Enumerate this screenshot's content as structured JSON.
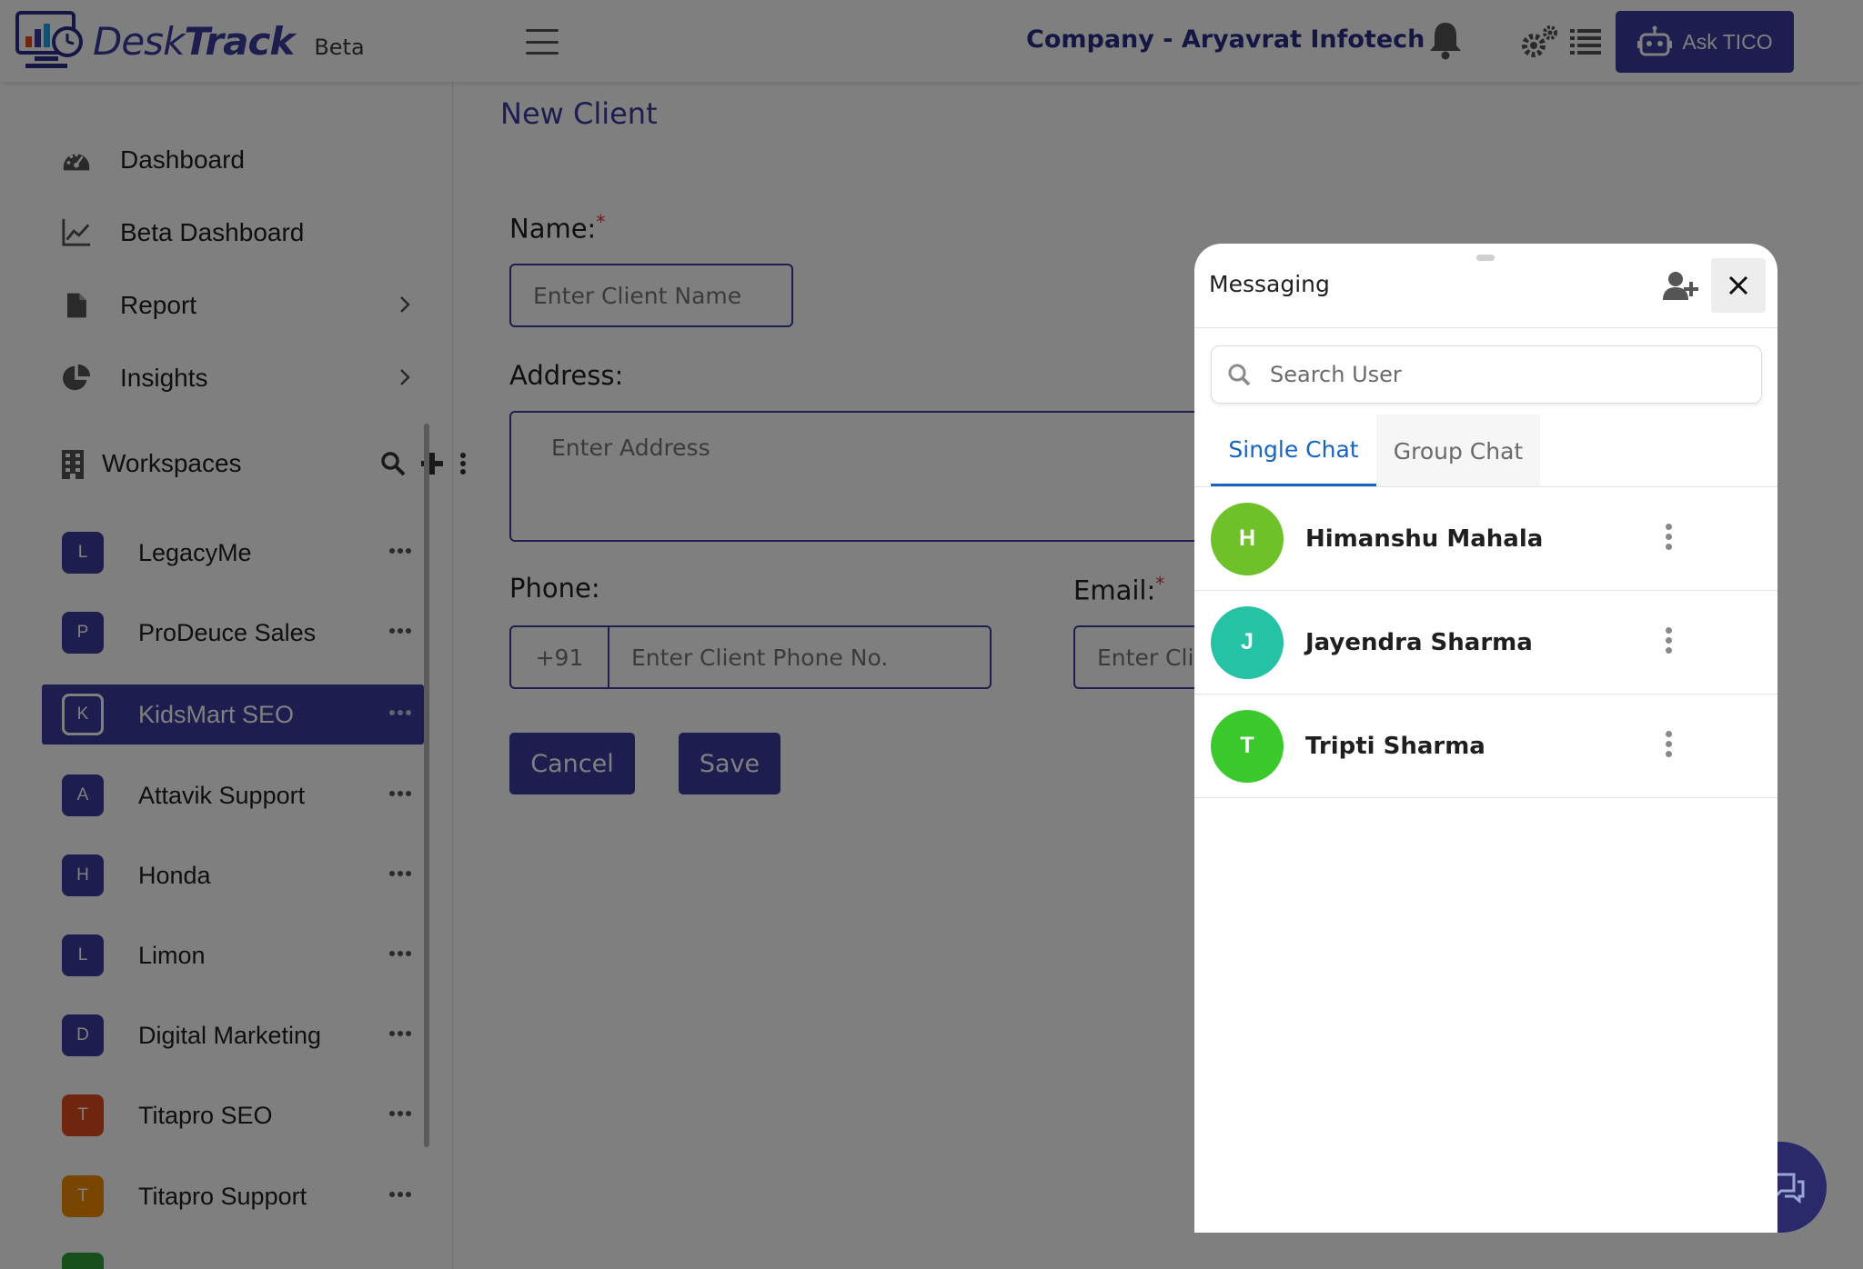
{
  "header": {
    "logo_main": "Desk",
    "logo_bold": "Track",
    "beta": "Beta",
    "company": "Company - Aryavrat Infotech",
    "ask_button": "Ask TICO"
  },
  "sidebar": {
    "nav": [
      {
        "label": "Dashboard",
        "icon": "dashboard-icon"
      },
      {
        "label": "Beta Dashboard",
        "icon": "chart-line-icon"
      },
      {
        "label": "Report",
        "icon": "file-icon"
      },
      {
        "label": "Insights",
        "icon": "pie-chart-icon"
      }
    ],
    "workspaces_label": "Workspaces",
    "workspaces": [
      {
        "letter": "L",
        "label": "LegacyMe",
        "color": "#3a3a9e"
      },
      {
        "letter": "P",
        "label": "ProDeuce Sales",
        "color": "#3a3a9e"
      },
      {
        "letter": "K",
        "label": "KidsMart SEO",
        "color": "#3a3a9e",
        "active": true
      },
      {
        "letter": "A",
        "label": "Attavik Support",
        "color": "#3a3a9e"
      },
      {
        "letter": "H",
        "label": "Honda",
        "color": "#3a3a9e"
      },
      {
        "letter": "L",
        "label": "Limon",
        "color": "#3a3a9e"
      },
      {
        "letter": "D",
        "label": "Digital Marketing",
        "color": "#3a3a9e"
      },
      {
        "letter": "T",
        "label": "Titapro SEO",
        "color": "#e04a1e"
      },
      {
        "letter": "T",
        "label": "Titapro Support",
        "color": "#f08c00"
      }
    ]
  },
  "form": {
    "title": "New Client",
    "name_label": "Name:",
    "name_placeholder": "Enter Client Name",
    "address_label": "Address:",
    "address_placeholder": "Enter Address",
    "phone_label": "Phone:",
    "phone_prefix": "+91",
    "phone_placeholder": "Enter Client Phone No.",
    "email_label": "Email:",
    "email_placeholder": "Enter Cli",
    "required_mark": "*",
    "cancel": "Cancel",
    "save": "Save"
  },
  "messaging": {
    "title": "Messaging",
    "search_placeholder": "Search User",
    "tabs": [
      "Single Chat",
      "Group Chat"
    ],
    "users": [
      {
        "initial": "H",
        "name": "Himanshu Mahala",
        "color": "#6fc12a"
      },
      {
        "initial": "J",
        "name": "Jayendra Sharma",
        "color": "#26c2a6"
      },
      {
        "initial": "T",
        "name": "Tripti Sharma",
        "color": "#3cc92e"
      }
    ]
  },
  "colors": {
    "brand": "#3a3a9e",
    "tab_active": "#1565c0"
  }
}
